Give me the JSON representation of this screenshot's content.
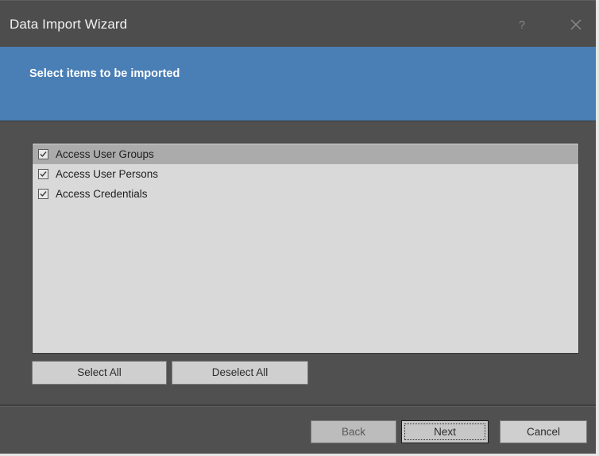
{
  "window": {
    "title": "Data Import Wizard",
    "help_glyph": "?",
    "close_icon": "close-icon"
  },
  "banner": {
    "heading": "Select items to be imported",
    "color": "#4a7fb5"
  },
  "items": [
    {
      "label": "Access User Groups",
      "checked": true,
      "selected": true
    },
    {
      "label": "Access User Persons",
      "checked": true,
      "selected": false
    },
    {
      "label": "Access Credentials",
      "checked": true,
      "selected": false
    }
  ],
  "list_buttons": {
    "select_all": "Select All",
    "deselect_all": "Deselect All"
  },
  "footer": {
    "back": "Back",
    "next": "Next",
    "cancel": "Cancel"
  }
}
